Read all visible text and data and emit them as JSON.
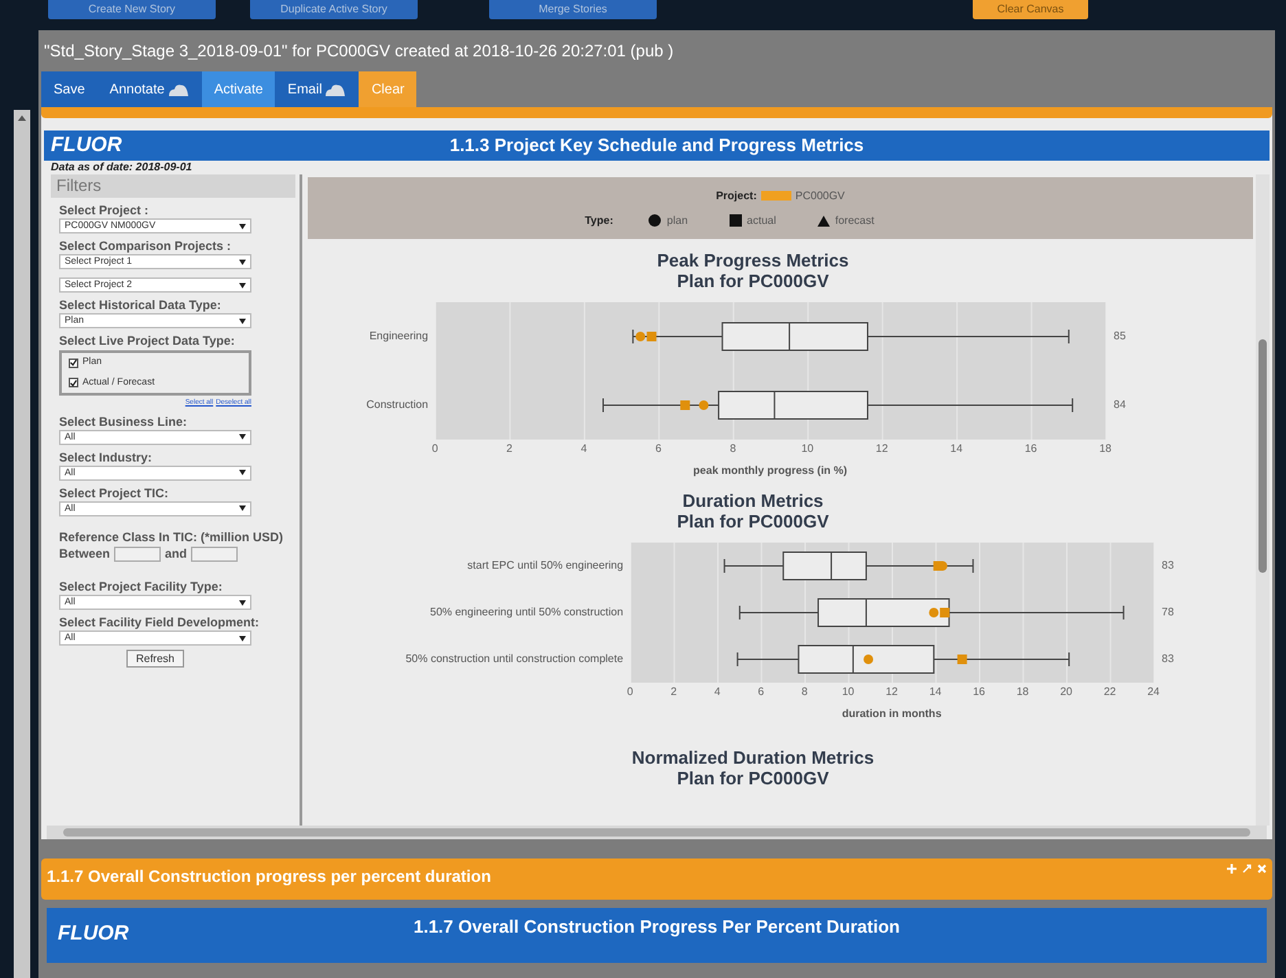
{
  "top_buttons": [
    {
      "label": "Create New Story",
      "kind": "blue"
    },
    {
      "label": "Duplicate Active Story",
      "kind": "blue"
    },
    {
      "label": "Merge Stories",
      "kind": "blue"
    },
    {
      "label": "Clear Canvas",
      "kind": "orange"
    }
  ],
  "window": {
    "title": "\"Std_Story_Stage 3_2018-09-01\" for PC000GV created at 2018-10-26 20:27:01 (pub )"
  },
  "toolbar": [
    {
      "label": "Save",
      "kind": "plain",
      "selected": false
    },
    {
      "label": "Annotate",
      "kind": "cloud",
      "selected": false
    },
    {
      "label": "Activate",
      "kind": "plain",
      "selected": true
    },
    {
      "label": "Email",
      "kind": "cloud",
      "selected": false
    },
    {
      "label": "Clear",
      "kind": "orange",
      "selected": false
    }
  ],
  "panel": {
    "logo": "FLUOR",
    "title": "1.1.3 Project Key Schedule and Progress Metrics",
    "data_date": "Data as of date: 2018-09-01"
  },
  "filters": {
    "heading": "Filters",
    "items": [
      {
        "kind": "select",
        "label": "Select Project :",
        "value": "PC000GV  NM000GV"
      },
      {
        "kind": "select",
        "label": "Select Comparison Projects :",
        "value": "Select Project 1"
      },
      {
        "kind": "select",
        "value": "Select Project 2"
      },
      {
        "kind": "select",
        "label": "Select Historical Data Type:",
        "value": "Plan"
      },
      {
        "kind": "checks",
        "label": "Select Live Project Data Type:",
        "options": [
          {
            "label": "Plan",
            "checked": true
          },
          {
            "label": "Actual / Forecast",
            "checked": true
          }
        ],
        "links": [
          "Select all",
          "Deselect all"
        ]
      },
      {
        "kind": "select",
        "label": "Select Business Line:",
        "value": "All"
      },
      {
        "kind": "select",
        "label": "Select Industry:",
        "value": "All"
      },
      {
        "kind": "select",
        "label": "Select Project TIC:",
        "value": "All"
      },
      {
        "kind": "range",
        "label": "Reference Class In TIC: (*million USD)",
        "from": "Between",
        "to": "and"
      },
      {
        "kind": "select",
        "label": "Select Project Facility Type:",
        "value": "All"
      },
      {
        "kind": "select",
        "label": "Select Facility Field Development:",
        "value": "All"
      },
      {
        "kind": "button",
        "label": "Refresh"
      }
    ]
  },
  "legend": {
    "project_label": "Project:",
    "project": "PC000GV",
    "type_label": "Type:",
    "types": [
      {
        "label": "plan",
        "kind": "circle"
      },
      {
        "label": "actual",
        "kind": "square"
      },
      {
        "label": "forecast",
        "kind": "triangle"
      }
    ]
  },
  "charts": [
    {
      "title": "Peak Progress Metrics",
      "subtitle": "Plan for PC000GV",
      "xlabel": "peak monthly progress (in %)",
      "xticks": [
        "0",
        "2",
        "4",
        "6",
        "8",
        "10",
        "12",
        "14",
        "16",
        "18"
      ],
      "rows": [
        {
          "label": "Engineering",
          "count": "85"
        },
        {
          "label": "Construction",
          "count": "84"
        }
      ]
    },
    {
      "title": "Duration Metrics",
      "subtitle": "Plan for PC000GV",
      "xlabel": "duration in months",
      "xticks": [
        "0",
        "2",
        "4",
        "6",
        "8",
        "10",
        "12",
        "14",
        "16",
        "18",
        "20",
        "22",
        "24"
      ],
      "rows": [
        {
          "label": "start EPC until 50% engineering",
          "count": "83"
        },
        {
          "label": "50% engineering until 50% construction",
          "count": "78"
        },
        {
          "label": "50% construction until construction complete",
          "count": "83"
        }
      ]
    },
    {
      "title": "Normalized Duration Metrics",
      "subtitle": "Plan for PC000GV"
    }
  ],
  "next_section": {
    "title": "1.1.7 Overall Construction progress per percent duration",
    "logo": "FLUOR",
    "panel_title": "1.1.7 Overall Construction Progress Per Percent Duration"
  }
}
